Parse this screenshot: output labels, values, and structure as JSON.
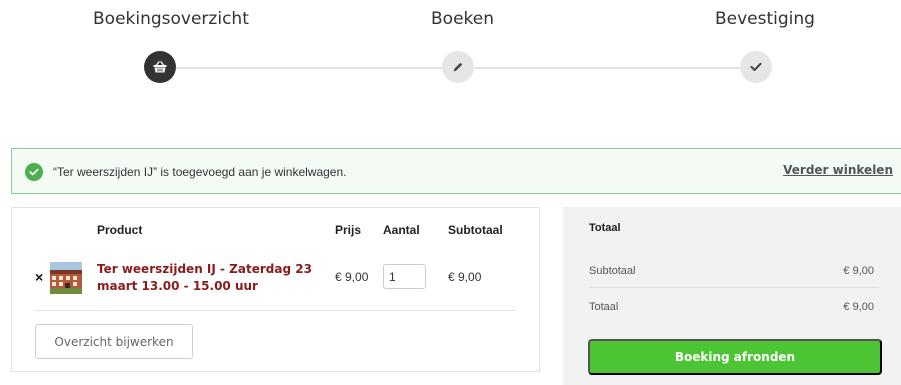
{
  "steps": [
    {
      "label": "Boekingsoverzicht",
      "icon": "basket-icon",
      "state": "active"
    },
    {
      "label": "Boeken",
      "icon": "pencil-icon",
      "state": "inactive"
    },
    {
      "label": "Bevestiging",
      "icon": "check-icon",
      "state": "inactive"
    }
  ],
  "notice": {
    "message": "“Ter weerszijden IJ” is toegevoegd aan je winkelwagen.",
    "link": "Verder winkelen"
  },
  "cart": {
    "headers": {
      "product": "Product",
      "price": "Prijs",
      "quantity": "Aantal",
      "subtotal": "Subtotaal"
    },
    "items": [
      {
        "remove": "×",
        "name": "Ter weerszijden IJ - Zaterdag 23 maart 13.00 - 15.00 uur",
        "price": "€ 9,00",
        "quantity": "1",
        "subtotal": "€ 9,00"
      }
    ],
    "update_button": "Overzicht bijwerken"
  },
  "totals": {
    "title": "Totaal",
    "subtotal_label": "Subtotaal",
    "subtotal_value": "€ 9,00",
    "total_label": "Totaal",
    "total_value": "€ 9,00",
    "checkout_button": "Boeking afronden"
  },
  "colors": {
    "accent_green": "#4cc434",
    "product_link": "#8a1c1c",
    "notice_border": "#8fce8f",
    "active_step": "#333333"
  }
}
